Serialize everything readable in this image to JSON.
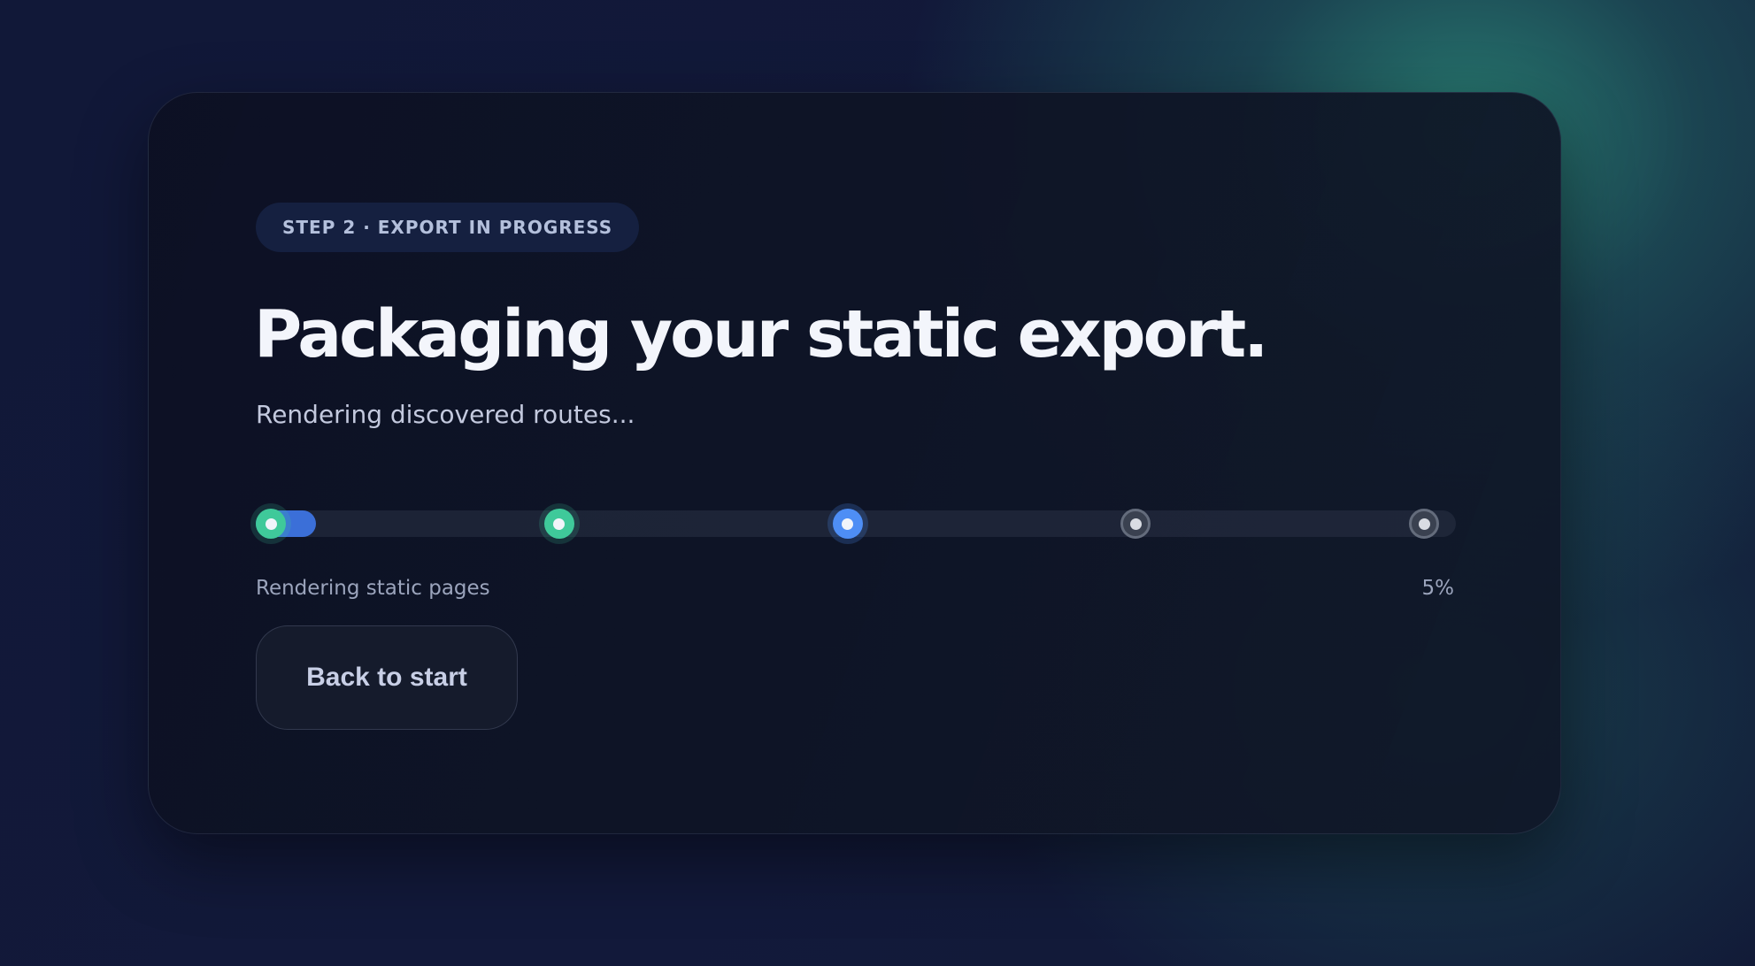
{
  "badge": "STEP 2 · EXPORT IN PROGRESS",
  "title": "Packaging your static export.",
  "subtitle": "Rendering discovered routes...",
  "progress": {
    "percent_label": "5%",
    "value_percent": 5,
    "stage_label": "Rendering static pages",
    "steps": [
      {
        "state": "done"
      },
      {
        "state": "done"
      },
      {
        "state": "active"
      },
      {
        "state": "pending"
      },
      {
        "state": "pending"
      }
    ]
  },
  "actions": {
    "back_label": "Back to start"
  },
  "colors": {
    "done": "#3fc99a",
    "active": "#4e8ef5",
    "pending": "#646c7c",
    "fill": "#3b6fd8"
  }
}
